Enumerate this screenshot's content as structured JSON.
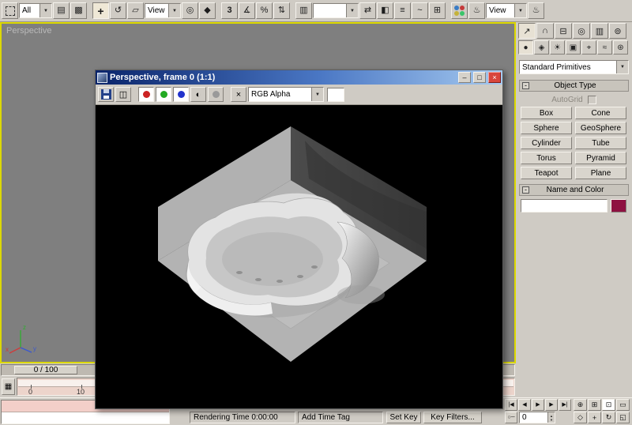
{
  "icons": {
    "dd_arrow": "▼",
    "select_by_name": "▤",
    "crossing": "▩",
    "move": "+",
    "rotate": "↺",
    "scale": "▱",
    "pivot_center": "◎",
    "manipulate": "◆",
    "snap": "3",
    "angle_snap": "∡",
    "percent_snap": "%",
    "spinner_snap": "⇅",
    "named_sets": "▥",
    "mirror": "⇄",
    "align": "◧",
    "layers": "≡",
    "curve_editor": "~",
    "schematic": "⊞",
    "render_scene": "♨",
    "quick_render": "♨",
    "minimize": "–",
    "maximize": "□",
    "close": "×",
    "clone": "◫",
    "mono": "◐",
    "clear": "×",
    "create": "↗",
    "modify": "∩",
    "hierarchy": "⊟",
    "motion": "◎",
    "display": "▥",
    "utilities": "⊚",
    "geometry": "●",
    "shapes": "◈",
    "lights": "☀",
    "cameras": "▣",
    "helpers": "⌖",
    "space_warps": "≈",
    "systems": "⊛",
    "rollout_collapse": "-",
    "goto_start": "|◀",
    "prev_frame": "◀",
    "play": "▶",
    "next_frame": "▶",
    "goto_end": "▶|",
    "key_mode": "○─",
    "zoom": "⊕",
    "zoom_all": "⊞",
    "zoom_extents": "⊡",
    "zoom_region": "▭",
    "fov": "◇",
    "pan": "+",
    "arc_rotate": "↻",
    "minmax_toggle": "◱",
    "mini_curve_editor": "▦",
    "spin_up": "▲",
    "spin_down": "▼"
  },
  "top_toolbar": {
    "selection_filter": "All",
    "coord_system": "View",
    "named_sets_value": "",
    "render_type": "View"
  },
  "viewport": {
    "label": "Perspective",
    "axis": {
      "x": "x",
      "y": "y",
      "z": "z"
    }
  },
  "render_window": {
    "title": "Perspective, frame 0 (1:1)",
    "channel_display": "RGB Alpha"
  },
  "command_panel": {
    "category_dropdown": "Standard Primitives",
    "object_type_rollout": "Object Type",
    "autogrid_label": "AutoGrid",
    "primitive_buttons": [
      "Box",
      "Cone",
      "Sphere",
      "GeoSphere",
      "Cylinder",
      "Tube",
      "Torus",
      "Pyramid",
      "Teapot",
      "Plane"
    ],
    "name_color_rollout": "Name and Color",
    "object_color": "#8e1141"
  },
  "timeline": {
    "slider_label": "0 / 100",
    "ticks": [
      "0",
      "10"
    ]
  },
  "bottom_bar": {
    "rendering_time": "Rendering Time  0:00:00",
    "add_time_tag": "Add Time Tag",
    "set_key": "Set Key",
    "key_filters": "Key Filters...",
    "frame_field": "0"
  }
}
